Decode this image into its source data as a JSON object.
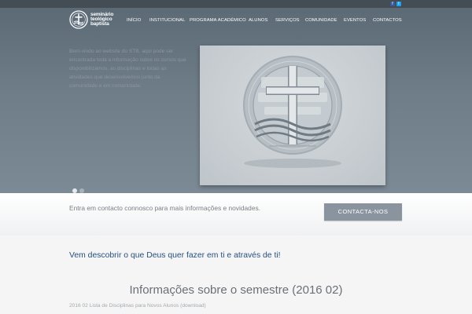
{
  "topbar": {
    "social": [
      {
        "icon": "facebook-icon",
        "glyph": "f",
        "color": "#3b5998"
      },
      {
        "icon": "twitter-icon",
        "glyph": "t",
        "color": "#1da1f2"
      }
    ]
  },
  "logo": {
    "line1": "seminário",
    "line2": "teológico",
    "line3": "baptista"
  },
  "nav": {
    "items": [
      "INÍCIO",
      "INSTITUCIONAL",
      "PROGRAMA ACADÉMICO",
      "ALUNOS",
      "SERVIÇOS",
      "COMUNIDADE",
      "EVENTOS",
      "CONTACTOS"
    ]
  },
  "hero": {
    "intro": "Bem-vindo ao website do STB, aqui pode ser encontrada toda a informação sobre os cursos que disponibilizamos, as disciplinas e todas as atividades que desenvolvemos junto da comunidade e em comunidade.",
    "slide_image": "seminary-seal",
    "slide_count": 2,
    "active_slide": 1
  },
  "cta": {
    "text": "Entra em contacto connosco para mais informações e novidades.",
    "button": "CONTACTA-NOS"
  },
  "content": {
    "tagline": "Vem descobrir o que Deus quer fazer em ti e através de ti!",
    "semester_title": "Informações sobre o semestre (2016 02)",
    "download_link": "2016 02 Lista de Disciplinas para Novos Alunos (download)"
  },
  "colors": {
    "hero_bg": "#6f7d89",
    "topbar_bg": "#444c54",
    "button_bg": "#8a949e",
    "tagline": "#25507f"
  }
}
